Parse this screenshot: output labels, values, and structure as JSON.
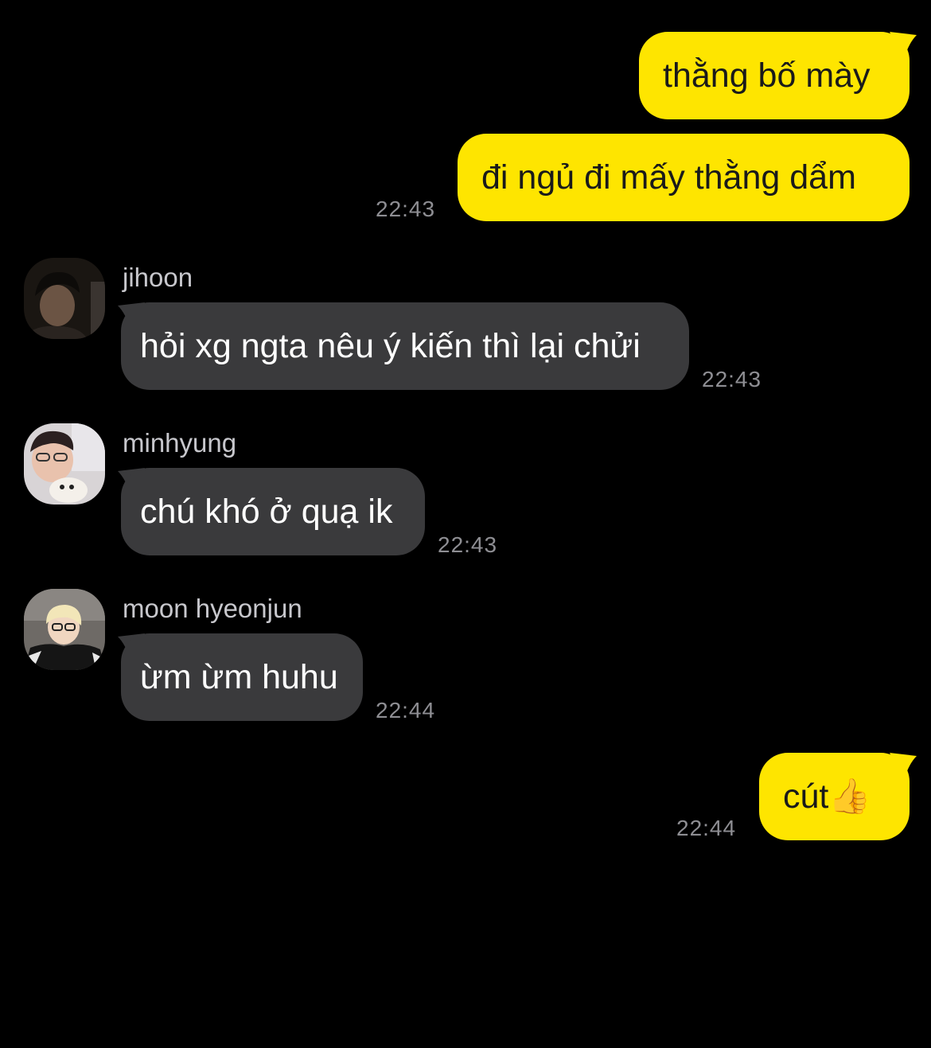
{
  "messages": [
    {
      "side": "out",
      "text": "thằng bố mày"
    },
    {
      "side": "out",
      "text": "đi ngủ đi mấy thằng dẩm",
      "time": "22:43"
    },
    {
      "side": "in",
      "sender": "jihoon",
      "text": "hỏi xg ngta nêu ý kiến thì lại chửi",
      "time": "22:43"
    },
    {
      "side": "in",
      "sender": "minhyung",
      "text": "chú khó ở quạ ik",
      "time": "22:43"
    },
    {
      "side": "in",
      "sender": "moon hyeonjun",
      "text": "ừm ừm huhu",
      "time": "22:44"
    },
    {
      "side": "out",
      "text": "cút",
      "emoji": "👍",
      "time": "22:44"
    }
  ],
  "colors": {
    "background": "#000000",
    "outgoing_bubble": "#FEE500",
    "incoming_bubble": "#3a3a3c",
    "timestamp": "#8e8e93"
  }
}
